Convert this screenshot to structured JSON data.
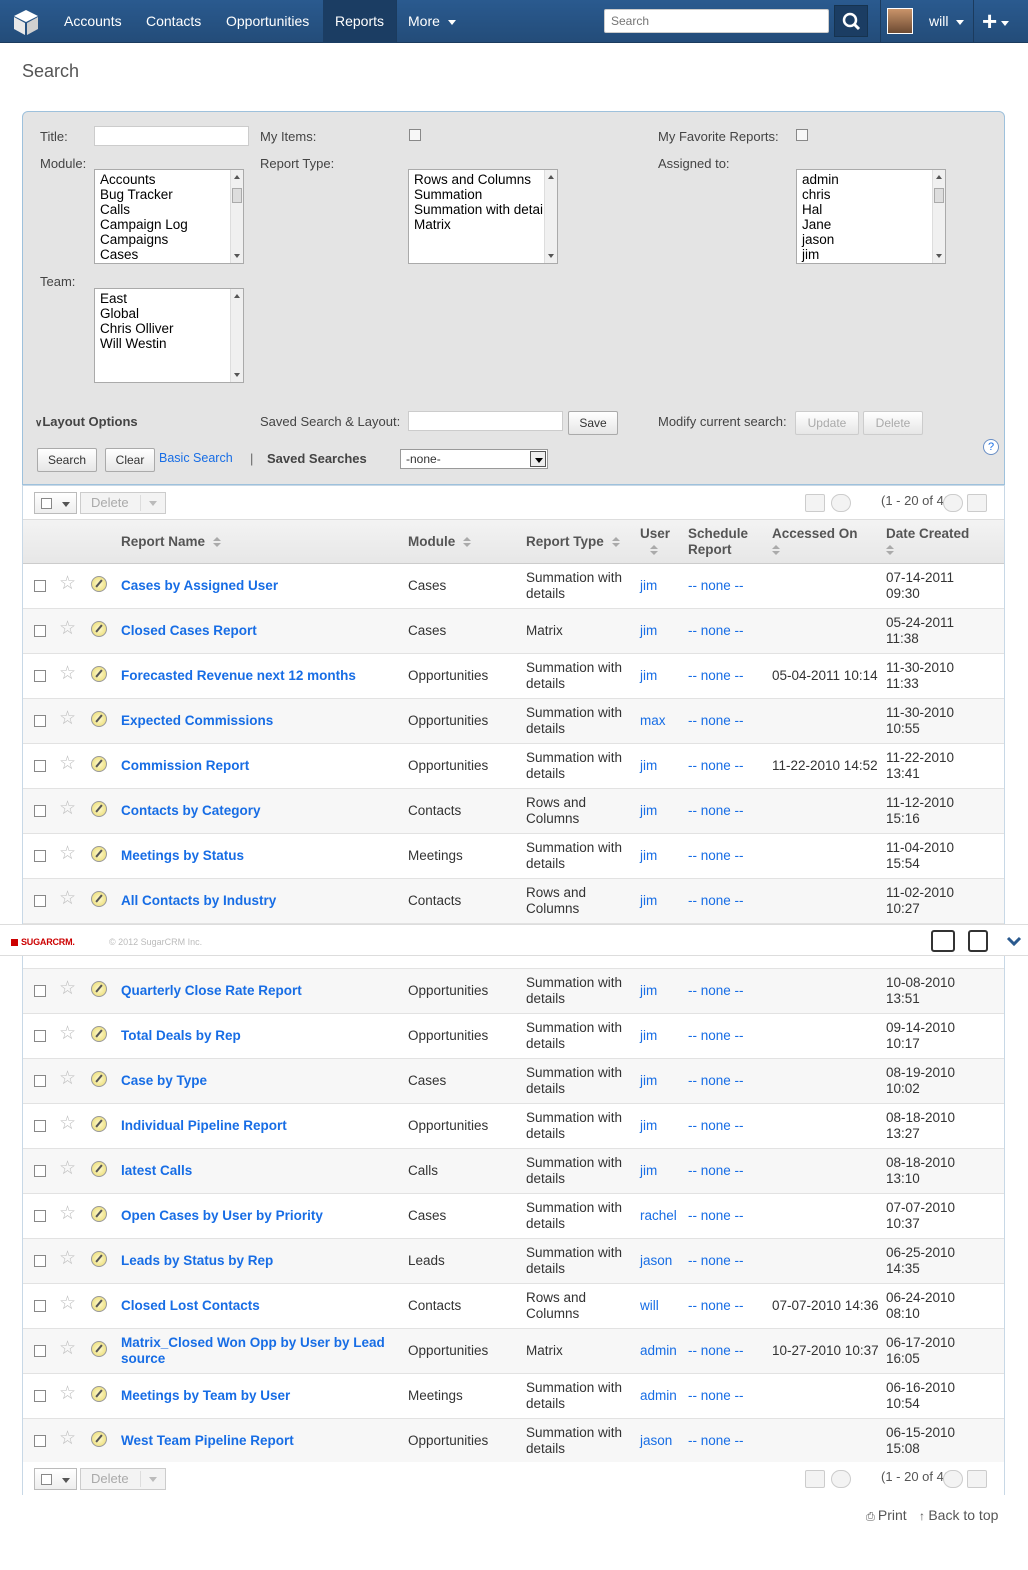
{
  "nav": {
    "items": [
      "Accounts",
      "Contacts",
      "Opportunities",
      "Reports",
      "More"
    ],
    "search_placeholder": "Search",
    "user": "will",
    "colors": {
      "nav_bg": "#2a5a8f",
      "active": "#1b3d63",
      "link": "#176de5"
    }
  },
  "page": {
    "title": "Search"
  },
  "search": {
    "title_label": "Title:",
    "my_items_label": "My Items:",
    "favorites_label": "My Favorite Reports:",
    "module_label": "Module:",
    "module_options": [
      "Accounts",
      "Bug Tracker",
      "Calls",
      "Campaign Log",
      "Campaigns",
      "Cases"
    ],
    "report_type_label": "Report Type:",
    "report_type_options": [
      "Rows and Columns",
      "Summation",
      "Summation with detai",
      "Matrix"
    ],
    "assigned_label": "Assigned to:",
    "assigned_options": [
      "admin",
      "chris",
      "Hal",
      "Jane",
      "jason",
      "jim"
    ],
    "team_label": "Team:",
    "team_options": [
      "East",
      "Global",
      "Chris Olliver",
      "Will Westin"
    ],
    "layout_options": "Layout Options",
    "saved_layout_label": "Saved Search & Layout:",
    "save_btn": "Save",
    "modify_label": "Modify current search:",
    "update_btn": "Update",
    "delete_btn": "Delete",
    "search_btn": "Search",
    "clear_btn": "Clear",
    "basic_search": "Basic Search",
    "separator": "|",
    "saved_searches_label": "Saved Searches",
    "saved_searches_value": "-none-",
    "help": "?"
  },
  "list": {
    "delete_label": "Delete",
    "pagination": "(1 - 20 of 40)",
    "headers": {
      "name": "Report Name",
      "module": "Module",
      "type": "Report Type",
      "user": "User",
      "schedule_1": "Schedule",
      "schedule_2": "Report",
      "accessed": "Accessed On",
      "created": "Date Created"
    },
    "rows": [
      {
        "name": "Cases by Assigned User",
        "module": "Cases",
        "type1": "Summation with",
        "type2": "details",
        "user": "jim",
        "sched": "-- none --",
        "accessed": "",
        "d1": "07-14-2011",
        "d2": "09:30"
      },
      {
        "name": "Closed Cases Report",
        "module": "Cases",
        "type1": "Matrix",
        "type2": "",
        "user": "jim",
        "sched": "-- none --",
        "accessed": "",
        "d1": "05-24-2011",
        "d2": "11:38"
      },
      {
        "name": "Forecasted Revenue next 12 months",
        "module": "Opportunities",
        "type1": "Summation with",
        "type2": "details",
        "user": "jim",
        "sched": "-- none --",
        "accessed": "05-04-2011 10:14",
        "d1": "11-30-2010",
        "d2": "11:33"
      },
      {
        "name": "Expected Commissions",
        "module": "Opportunities",
        "type1": "Summation with",
        "type2": "details",
        "user": "max",
        "sched": "-- none --",
        "accessed": "",
        "d1": "11-30-2010",
        "d2": "10:55"
      },
      {
        "name": "Commission Report",
        "module": "Opportunities",
        "type1": "Summation with",
        "type2": "details",
        "user": "jim",
        "sched": "-- none --",
        "accessed": "11-22-2010 14:52",
        "d1": "11-22-2010",
        "d2": "13:41"
      },
      {
        "name": "Contacts by Category",
        "module": "Contacts",
        "type1": "Rows and",
        "type2": "Columns",
        "user": "jim",
        "sched": "-- none --",
        "accessed": "",
        "d1": "11-12-2010",
        "d2": "15:16"
      },
      {
        "name": "Meetings by Status",
        "module": "Meetings",
        "type1": "Summation with",
        "type2": "details",
        "user": "jim",
        "sched": "-- none --",
        "accessed": "",
        "d1": "11-04-2010",
        "d2": "15:54"
      },
      {
        "name": "All Contacts by Industry",
        "module": "Contacts",
        "type1": "Rows and",
        "type2": "Columns",
        "user": "jim",
        "sched": "-- none --",
        "accessed": "",
        "d1": "11-02-2010",
        "d2": "10:27"
      },
      {
        "name": "",
        "module": "",
        "type1": "details",
        "type2": "",
        "user": "",
        "sched": "",
        "accessed": "",
        "d1": "10:02",
        "d2": ""
      },
      {
        "name": "Quarterly Close Rate Report",
        "module": "Opportunities",
        "type1": "Summation with",
        "type2": "details",
        "user": "jim",
        "sched": "-- none --",
        "accessed": "",
        "d1": "10-08-2010",
        "d2": "13:51"
      },
      {
        "name": "Total Deals by Rep",
        "module": "Opportunities",
        "type1": "Summation with",
        "type2": "details",
        "user": "jim",
        "sched": "-- none --",
        "accessed": "",
        "d1": "09-14-2010",
        "d2": "10:17"
      },
      {
        "name": "Case by Type",
        "module": "Cases",
        "type1": "Summation with",
        "type2": "details",
        "user": "jim",
        "sched": "-- none --",
        "accessed": "",
        "d1": "08-19-2010",
        "d2": "10:02"
      },
      {
        "name": "Individual Pipeline Report",
        "module": "Opportunities",
        "type1": "Summation with",
        "type2": "details",
        "user": "jim",
        "sched": "-- none --",
        "accessed": "",
        "d1": "08-18-2010",
        "d2": "13:27"
      },
      {
        "name": "latest Calls",
        "module": "Calls",
        "type1": "Summation with",
        "type2": "details",
        "user": "jim",
        "sched": "-- none --",
        "accessed": "",
        "d1": "08-18-2010",
        "d2": "13:10"
      },
      {
        "name": "Open Cases by User by Priority",
        "module": "Cases",
        "type1": "Summation with",
        "type2": "details",
        "user": "rachel",
        "sched": "-- none --",
        "accessed": "",
        "d1": "07-07-2010",
        "d2": "10:37"
      },
      {
        "name": "Leads by Status by Rep",
        "module": "Leads",
        "type1": "Summation with",
        "type2": "details",
        "user": "jason",
        "sched": "-- none --",
        "accessed": "",
        "d1": "06-25-2010",
        "d2": "14:35"
      },
      {
        "name": "Closed Lost Contacts",
        "module": "Contacts",
        "type1": "Rows and",
        "type2": "Columns",
        "user": "will",
        "sched": "-- none --",
        "accessed": "07-07-2010 14:36",
        "d1": "06-24-2010",
        "d2": "08:10"
      },
      {
        "name": "Matrix_Closed Won Opp by User by Lead",
        "name2": "source",
        "module": "Opportunities",
        "type1": "Matrix",
        "type2": "",
        "user": "admin",
        "sched": "-- none --",
        "accessed": "10-27-2010 10:37",
        "d1": "06-17-2010",
        "d2": "16:05"
      },
      {
        "name": "Meetings by Team by User",
        "module": "Meetings",
        "type1": "Summation with",
        "type2": "details",
        "user": "admin",
        "sched": "-- none --",
        "accessed": "",
        "d1": "06-16-2010",
        "d2": "10:54"
      },
      {
        "name": "West Team Pipeline Report",
        "module": "Opportunities",
        "type1": "Summation with",
        "type2": "details",
        "user": "jason",
        "sched": "-- none --",
        "accessed": "",
        "d1": "06-15-2010",
        "d2": "15:08"
      }
    ]
  },
  "footer": {
    "brand": "SUGARCRM.",
    "copyright": "© 2012 SugarCRM Inc.",
    "print": "Print",
    "back_to_top": "Back to top"
  }
}
